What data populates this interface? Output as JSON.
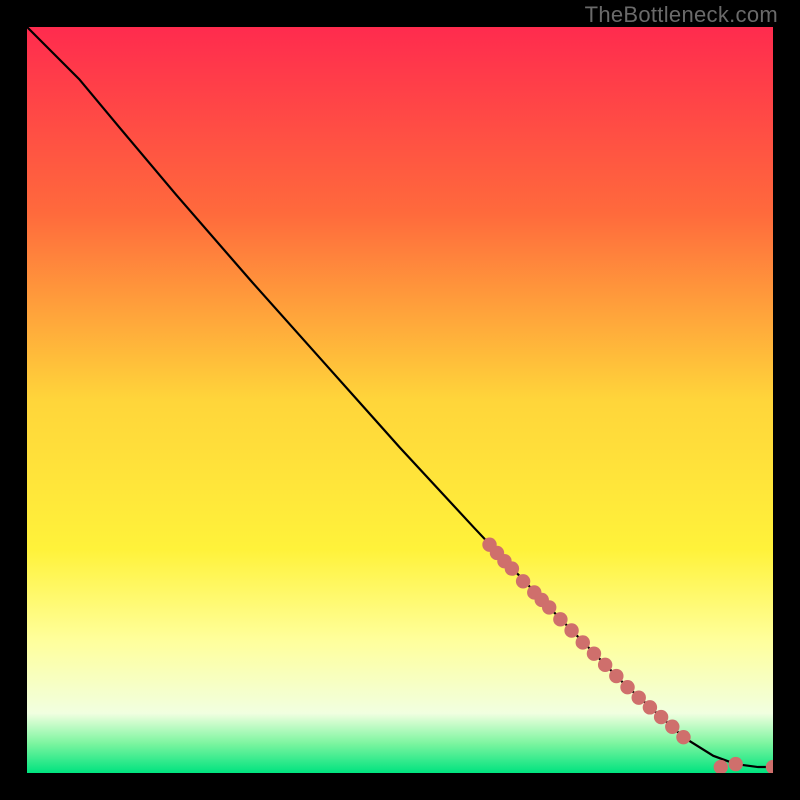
{
  "watermark": "TheBottleneck.com",
  "chart_data": {
    "type": "line",
    "title": "",
    "xlabel": "",
    "ylabel": "",
    "xlim": [
      0,
      100
    ],
    "ylim": [
      0,
      100
    ],
    "gradient_stops": [
      {
        "offset": 0,
        "color": "#ff2b4e"
      },
      {
        "offset": 25,
        "color": "#ff6a3c"
      },
      {
        "offset": 50,
        "color": "#ffd53a"
      },
      {
        "offset": 70,
        "color": "#fff23a"
      },
      {
        "offset": 82,
        "color": "#ffff9a"
      },
      {
        "offset": 92,
        "color": "#f1ffe0"
      },
      {
        "offset": 96,
        "color": "#7df5a0"
      },
      {
        "offset": 100,
        "color": "#00e37f"
      }
    ],
    "curve": [
      {
        "x": 0,
        "y": 100
      },
      {
        "x": 3,
        "y": 97
      },
      {
        "x": 7,
        "y": 93
      },
      {
        "x": 12,
        "y": 87
      },
      {
        "x": 20,
        "y": 77.5
      },
      {
        "x": 30,
        "y": 66
      },
      {
        "x": 40,
        "y": 54.8
      },
      {
        "x": 50,
        "y": 43.6
      },
      {
        "x": 60,
        "y": 32.8
      },
      {
        "x": 70,
        "y": 22.2
      },
      {
        "x": 80,
        "y": 12
      },
      {
        "x": 88,
        "y": 4.8
      },
      {
        "x": 92,
        "y": 2.3
      },
      {
        "x": 95,
        "y": 1.2
      },
      {
        "x": 98,
        "y": 0.8
      },
      {
        "x": 100,
        "y": 0.8
      }
    ],
    "markers": [
      {
        "x": 62,
        "y": 30.6
      },
      {
        "x": 63,
        "y": 29.5
      },
      {
        "x": 64,
        "y": 28.4
      },
      {
        "x": 65,
        "y": 27.4
      },
      {
        "x": 66.5,
        "y": 25.7
      },
      {
        "x": 68,
        "y": 24.2
      },
      {
        "x": 69,
        "y": 23.2
      },
      {
        "x": 70,
        "y": 22.2
      },
      {
        "x": 71.5,
        "y": 20.6
      },
      {
        "x": 73,
        "y": 19.1
      },
      {
        "x": 74.5,
        "y": 17.5
      },
      {
        "x": 76,
        "y": 16.0
      },
      {
        "x": 77.5,
        "y": 14.5
      },
      {
        "x": 79,
        "y": 13.0
      },
      {
        "x": 80.5,
        "y": 11.5
      },
      {
        "x": 82,
        "y": 10.1
      },
      {
        "x": 83.5,
        "y": 8.8
      },
      {
        "x": 85,
        "y": 7.5
      },
      {
        "x": 86.5,
        "y": 6.2
      },
      {
        "x": 88,
        "y": 4.8
      },
      {
        "x": 93,
        "y": 0.8
      },
      {
        "x": 95,
        "y": 1.2
      },
      {
        "x": 100,
        "y": 0.8
      }
    ]
  }
}
